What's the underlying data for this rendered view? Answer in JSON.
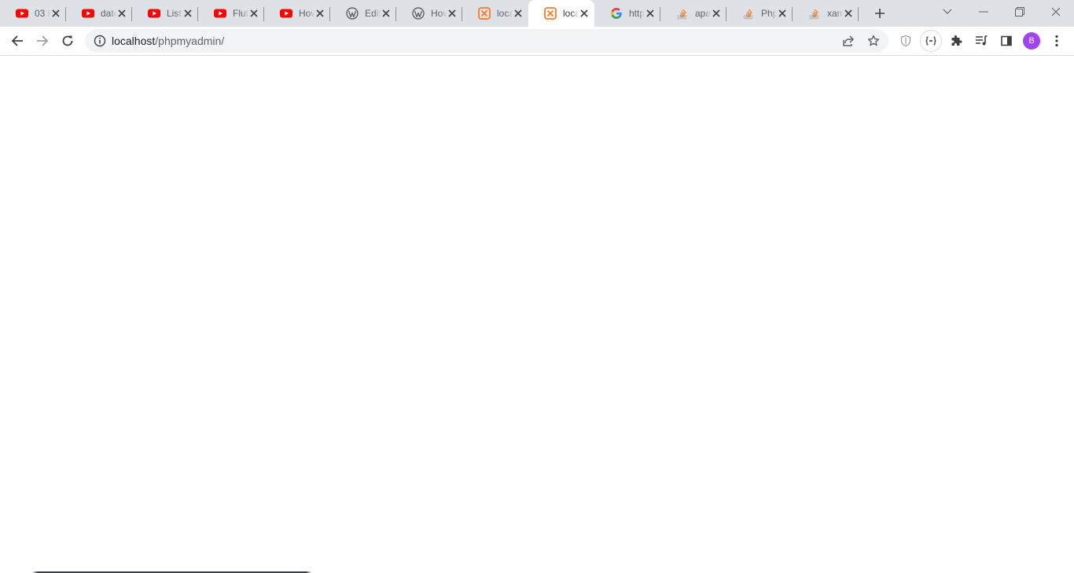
{
  "tabs": [
    {
      "title": "03 H",
      "favicon": "youtube-icon"
    },
    {
      "title": "date",
      "favicon": "youtube-icon"
    },
    {
      "title": "List",
      "favicon": "youtube-icon"
    },
    {
      "title": "Flut",
      "favicon": "youtube-icon"
    },
    {
      "title": "How",
      "favicon": "youtube-icon"
    },
    {
      "title": "Edit",
      "favicon": "wordpress-icon"
    },
    {
      "title": "How",
      "favicon": "wordpress-icon"
    },
    {
      "title": "loca",
      "favicon": "xampp-icon"
    },
    {
      "title": "loca",
      "favicon": "xampp-icon",
      "active": true
    },
    {
      "title": "http",
      "favicon": "google-icon"
    },
    {
      "title": "apa",
      "favicon": "stackoverflow-icon"
    },
    {
      "title": "Php",
      "favicon": "stackoverflow-icon"
    },
    {
      "title": "xam",
      "favicon": "stackoverflow-icon"
    }
  ],
  "omnibox": {
    "host": "localhost",
    "path": "/phpmyadmin/"
  },
  "profile": {
    "initial": "B",
    "color": "#a142f4"
  },
  "colors": {
    "tabstrip": "#dee1e6",
    "youtube": "#ff0000",
    "xampp": "#fb7a24",
    "stackoverflow": "#f48024",
    "wordpress": "#5f6368"
  }
}
